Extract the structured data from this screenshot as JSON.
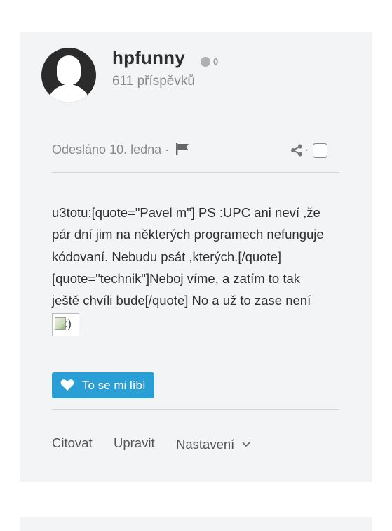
{
  "author": {
    "name": "hpfunny",
    "reputation": "0",
    "post_count": "611 příspěvků"
  },
  "post": {
    "meta": "Odesláno 10. ledna ·",
    "share_separator": "·",
    "content_lines": [
      "u3totu:[quote=\"Pavel m\"] PS :UPC ani neví ,že",
      "pár dní jim na některých programech nefunguje",
      "kódovaní. Nebudu psát ,kterých.[/quote]",
      "[quote=\"technik\"]Neboj víme, a zatím to tak",
      "ještě chvíli bude[/quote] No a už to zase není"
    ],
    "emoticon_alt": ":)"
  },
  "like_button": {
    "label": "To se mi líbí"
  },
  "actions": {
    "quote": "Citovat",
    "edit": "Upravit",
    "settings": "Nastavení"
  },
  "colors": {
    "accent": "#2a9fd6",
    "panel": "#f3f4f5",
    "muted_text": "#888888"
  }
}
